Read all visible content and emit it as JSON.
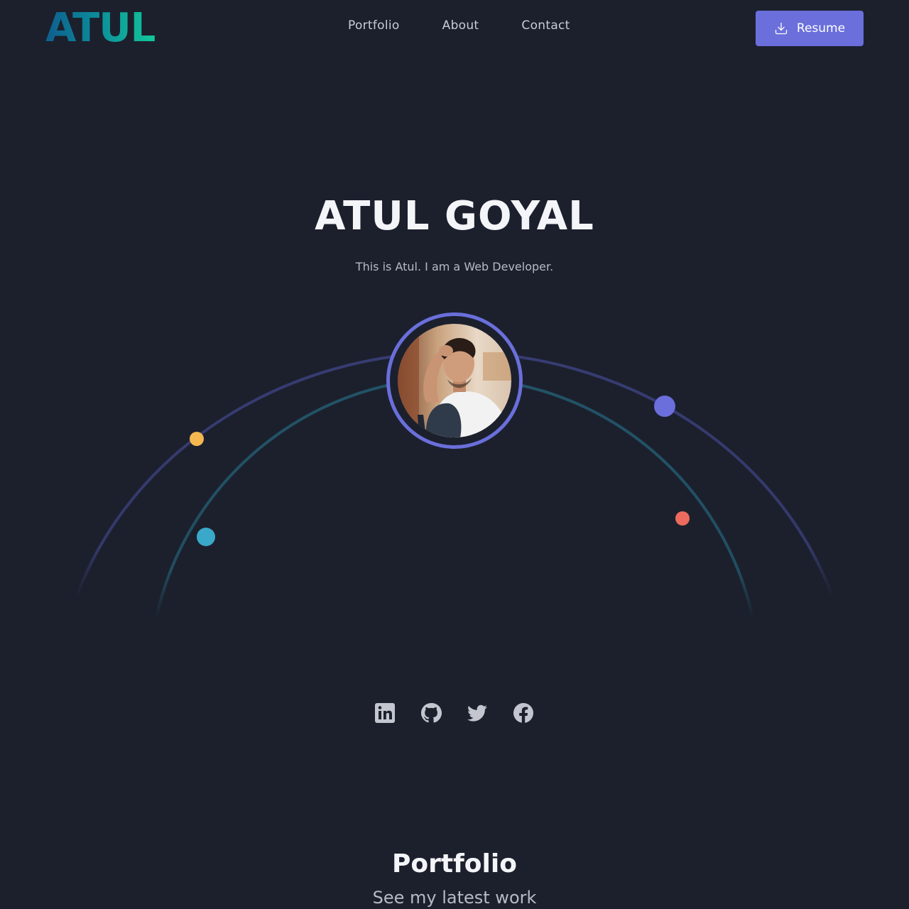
{
  "header": {
    "logo": "ATUL",
    "nav": [
      {
        "label": "Portfolio"
      },
      {
        "label": "About"
      },
      {
        "label": "Contact"
      }
    ],
    "resume_label": "Resume"
  },
  "hero": {
    "name": "ATUL GOYAL",
    "tagline": "This is Atul. I am a Web Developer."
  },
  "social": [
    {
      "icon": "linkedin-icon"
    },
    {
      "icon": "github-icon"
    },
    {
      "icon": "twitter-icon"
    },
    {
      "icon": "facebook-icon"
    }
  ],
  "portfolio": {
    "title": "Portfolio",
    "subtitle": "See my latest work"
  },
  "colors": {
    "background": "#1c202d",
    "accent": "#6a6fdb",
    "orbit_outer": "#3a3f7a",
    "orbit_inner": "#22566a",
    "dot_yellow": "#f5b84f",
    "dot_blue": "#6a6fdb",
    "dot_teal": "#3aa9c9",
    "dot_red": "#ec6a5e"
  }
}
